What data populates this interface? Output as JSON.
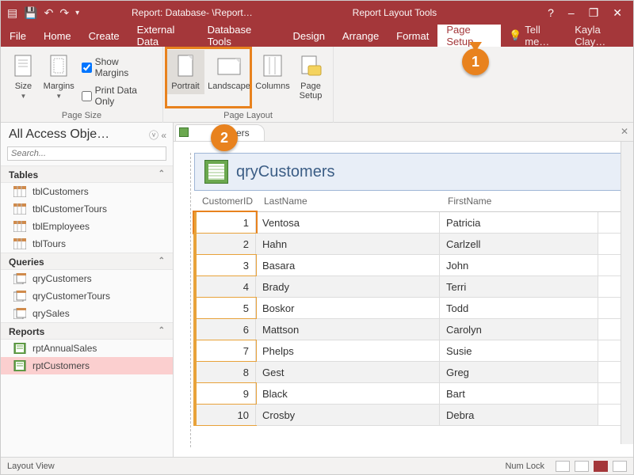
{
  "titlebar": {
    "app_title": "Report: Database- \\Report…",
    "tool_title": "Report Layout Tools",
    "qatb_icons": [
      "db-icon",
      "save-icon",
      "undo-icon",
      "redo-icon"
    ],
    "win_help": "?",
    "win_min": "–",
    "win_restore": "❐",
    "win_close": "✕"
  },
  "menubar": {
    "tabs": [
      "File",
      "Home",
      "Create",
      "External Data",
      "Database Tools",
      "Design",
      "Arrange",
      "Format",
      "Page Setup"
    ],
    "active_index": 8,
    "tell_me": "Tell me…",
    "user": "Kayla Clay…"
  },
  "ribbon": {
    "groups": {
      "page_size": {
        "label": "Page Size",
        "size_btn": "Size",
        "margins_btn": "Margins",
        "show_margins": "Show Margins",
        "show_margins_checked": true,
        "print_data_only": "Print Data Only",
        "print_data_only_checked": false
      },
      "page_layout": {
        "label": "Page Layout",
        "portrait": "Portrait",
        "landscape": "Landscape",
        "columns": "Columns",
        "page_setup": "Page\nSetup"
      }
    }
  },
  "callouts": {
    "one": "1",
    "two": "2"
  },
  "nav": {
    "title": "All Access Obje…",
    "search": "Search...",
    "sections": [
      {
        "label": "Tables",
        "items": [
          "tblCustomers",
          "tblCustomerTours",
          "tblEmployees",
          "tblTours"
        ],
        "icon": "table"
      },
      {
        "label": "Queries",
        "items": [
          "qryCustomers",
          "qryCustomerTours",
          "qrySales"
        ],
        "icon": "query"
      },
      {
        "label": "Reports",
        "items": [
          "rptAnnualSales",
          "rptCustomers"
        ],
        "icon": "report",
        "selected_index": 1
      }
    ]
  },
  "doc_tab": {
    "label": "tomers"
  },
  "report": {
    "title": "qryCustomers",
    "columns": [
      "CustomerID",
      "LastName",
      "FirstName"
    ],
    "rows": [
      {
        "id": "1",
        "ln": "Ventosa",
        "fn": "Patricia"
      },
      {
        "id": "2",
        "ln": "Hahn",
        "fn": "Carlzell"
      },
      {
        "id": "3",
        "ln": "Basara",
        "fn": "John"
      },
      {
        "id": "4",
        "ln": "Brady",
        "fn": "Terri"
      },
      {
        "id": "5",
        "ln": "Boskor",
        "fn": "Todd"
      },
      {
        "id": "6",
        "ln": "Mattson",
        "fn": "Carolyn"
      },
      {
        "id": "7",
        "ln": "Phelps",
        "fn": "Susie"
      },
      {
        "id": "8",
        "ln": "Gest",
        "fn": "Greg"
      },
      {
        "id": "9",
        "ln": "Black",
        "fn": "Bart"
      },
      {
        "id": "10",
        "ln": "Crosby",
        "fn": "Debra"
      }
    ]
  },
  "statusbar": {
    "left": "Layout View",
    "numlock": "Num Lock"
  }
}
